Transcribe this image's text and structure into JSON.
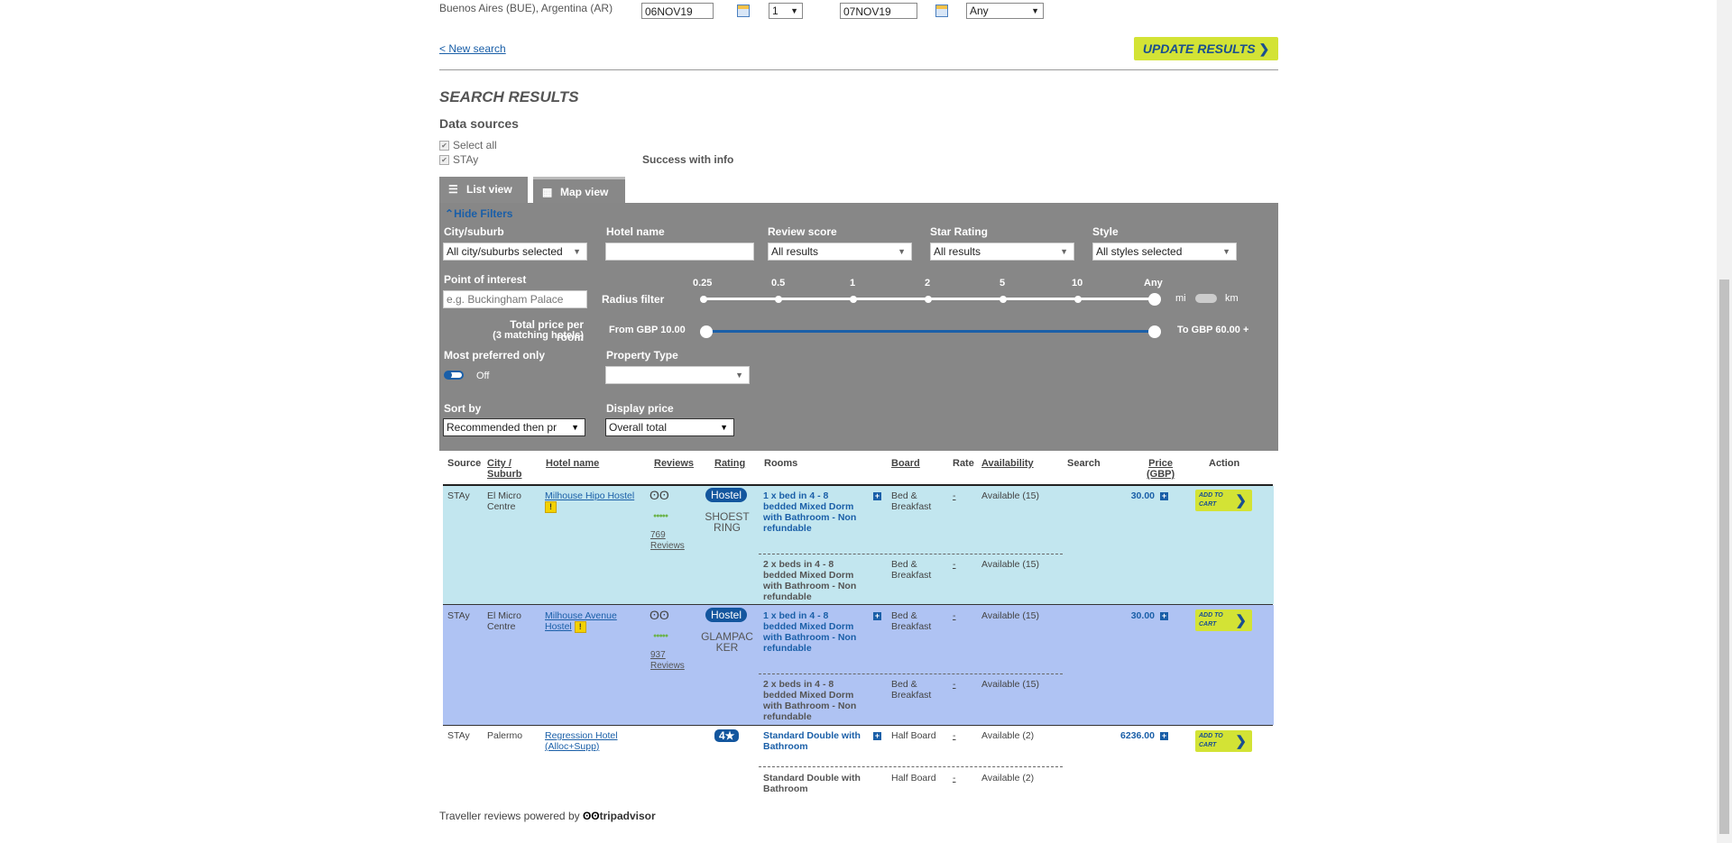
{
  "search": {
    "destination": "Buenos Aires (BUE), Argentina (AR)",
    "checkin": "06NOV19",
    "nights": "1",
    "checkout": "07NOV19",
    "rooms_any": "Any"
  },
  "new_search_label": "< New search",
  "update_label": "UPDATE RESULTS",
  "results_heading": "SEARCH RESULTS",
  "data_sources_heading": "Data sources",
  "select_all_label": "Select all",
  "source_label": "STAy",
  "source_status": "Success with info",
  "tabs": [
    {
      "label": "List view"
    },
    {
      "label": "Map view"
    }
  ],
  "filters": {
    "hide_label": "Hide Filters",
    "city_label": "City/suburb",
    "city_value": "All city/suburbs selected",
    "hotel_name_label": "Hotel name",
    "review_label": "Review score",
    "review_value": "All results",
    "star_label": "Star Rating",
    "star_value": "All results",
    "style_label": "Style",
    "style_value": "All styles selected",
    "poi_label": "Point of interest",
    "poi_placeholder": "e.g. Buckingham Palace",
    "radius_label": "Radius filter",
    "radius_ticks": [
      "0.25",
      "0.5",
      "1",
      "2",
      "5",
      "10",
      "Any"
    ],
    "unit_mi": "mi",
    "unit_km": "km",
    "price_label": "Total price per room",
    "price_sub": "(3 matching hotels)",
    "price_from": "From GBP 10.00",
    "price_to": "To GBP 60.00 +",
    "preferred_label": "Most preferred only",
    "preferred_value": "Off",
    "property_label": "Property Type",
    "property_value": "",
    "sort_label": "Sort by",
    "sort_value": "Recommended then pr",
    "display_label": "Display price",
    "display_value": "Overall total"
  },
  "table": {
    "headers": {
      "source": "Source",
      "city1": "City /",
      "city2": "Suburb",
      "hotel": "Hotel name",
      "reviews": "Reviews",
      "rating": "Rating",
      "rooms": "Rooms",
      "board": "Board",
      "rate": "Rate",
      "availability": "Availability",
      "search": "Search",
      "price1": "Price",
      "price2": "(GBP)",
      "action": "Action"
    },
    "add_to_cart": "ADD TO CART",
    "rows": [
      {
        "source": "STAy",
        "city": "El Micro Centre",
        "hotel": "Milhouse Hipo Hostel",
        "reviews": "769 Reviews",
        "rating_badge": "Hostel",
        "rating_sub": "SHOESTRING",
        "room1": "1 x bed in 4 - 8 bedded Mixed Dorm with Bathroom - Non refundable",
        "board1": "Bed & Breakfast",
        "rate1": "-",
        "avail1": "Available (15)",
        "price": "30.00",
        "room2": "2 x beds in 4 - 8 bedded Mixed Dorm with Bathroom - Non refundable",
        "board2": "Bed & Breakfast",
        "rate2": "-",
        "avail2": "Available (15)"
      },
      {
        "source": "STAy",
        "city": "El Micro Centre",
        "hotel": "Milhouse Avenue Hostel",
        "reviews": "937 Reviews",
        "rating_badge": "Hostel",
        "rating_sub": "GLAMPACKER",
        "room1": "1 x bed in 4 - 8 bedded Mixed Dorm with Bathroom - Non refundable",
        "board1": "Bed & Breakfast",
        "rate1": "-",
        "avail1": "Available (15)",
        "price": "30.00",
        "room2": "2 x beds in 4 - 8 bedded Mixed Dorm with Bathroom - Non refundable",
        "board2": "Bed & Breakfast",
        "rate2": "-",
        "avail2": "Available (15)"
      },
      {
        "source": "STAy",
        "city": "Palermo",
        "hotel": "Regression Hotel (Alloc+Supp)",
        "rating_badge": "4★",
        "room1": "Standard Double with Bathroom",
        "board1": "Half Board",
        "rate1": "-",
        "avail1": "Available (2)",
        "price": "6236.00",
        "room2": "Standard Double with Bathroom",
        "board2": "Half Board",
        "rate2": "-",
        "avail2": "Available (2)"
      }
    ]
  },
  "footer": {
    "powered": "Traveller reviews powered by",
    "brand": "tripadvisor"
  },
  "colors": {
    "accent_blue": "#1a5fa8",
    "button_green": "#d3e335",
    "filter_gray": "#878787",
    "row1_bg": "#c2e6ef",
    "row2_bg": "#afc3f3"
  }
}
